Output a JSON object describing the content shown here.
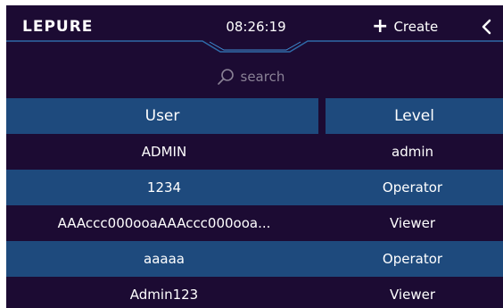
{
  "header": {
    "logo_text": "LEPURE",
    "time": "08:26:19",
    "create_label": "Create",
    "accent_color": "#1e4a7d"
  },
  "search": {
    "placeholder": "search"
  },
  "table": {
    "columns": [
      "User",
      "Level"
    ],
    "rows": [
      {
        "user": "ADMIN",
        "level": "admin"
      },
      {
        "user": "1234",
        "level": "Operator"
      },
      {
        "user": "AAAccc000ooaAAAccc000ooa...",
        "level": "Viewer"
      },
      {
        "user": "aaaaa",
        "level": "Operator"
      },
      {
        "user": "Admin123",
        "level": "Viewer"
      }
    ]
  },
  "colors": {
    "background": "#1c0b33",
    "row_alt": "#1e4a7d",
    "text": "#ffffff",
    "muted": "#8a8296"
  }
}
